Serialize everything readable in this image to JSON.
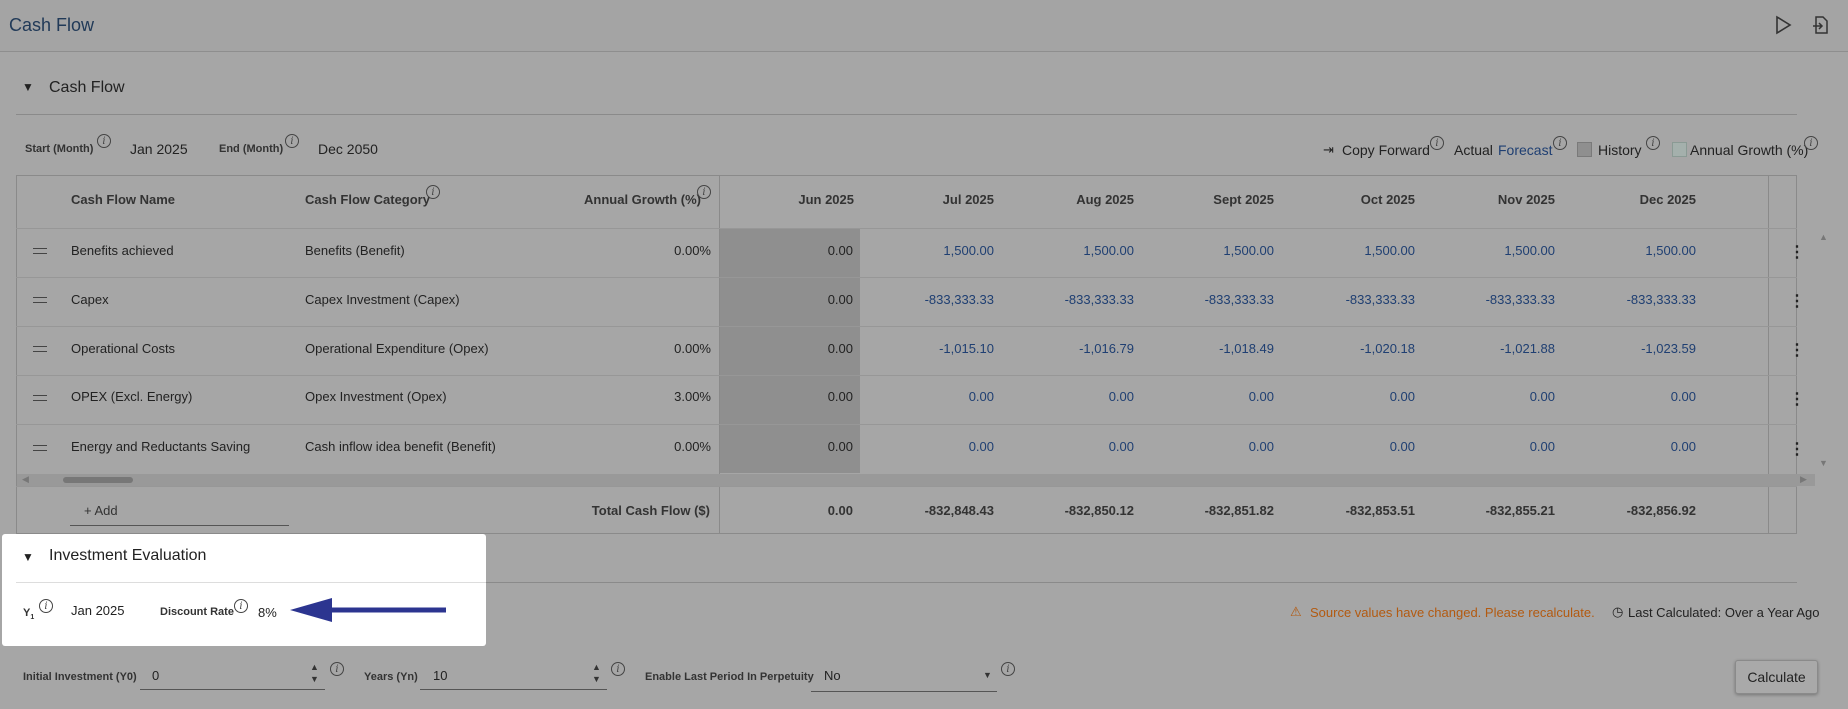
{
  "app": {
    "title": "Cash Flow"
  },
  "cashflow_section": {
    "title": "Cash Flow",
    "start_label": "Start (Month)",
    "start_value": "Jan 2025",
    "end_label": "End (Month)",
    "end_value": "Dec 2050",
    "legend": {
      "copy_forward": "Copy Forward",
      "actual": "Actual",
      "forecast": "Forecast",
      "history": "History",
      "annual_growth": "Annual Growth (%)"
    }
  },
  "grid": {
    "headers": {
      "name": "Cash Flow Name",
      "category": "Cash Flow Category",
      "growth": "Annual Growth (%)",
      "months": [
        "Jun 2025",
        "Jul 2025",
        "Aug 2025",
        "Sept 2025",
        "Oct 2025",
        "Nov 2025",
        "Dec 2025"
      ]
    },
    "rows": [
      {
        "name": "Benefits achieved",
        "category": "Benefits (Benefit)",
        "growth": "0.00%",
        "values": [
          "0.00",
          "1,500.00",
          "1,500.00",
          "1,500.00",
          "1,500.00",
          "1,500.00",
          "1,500.00"
        ]
      },
      {
        "name": "Capex",
        "category": "Capex Investment (Capex)",
        "growth": "",
        "values": [
          "0.00",
          "-833,333.33",
          "-833,333.33",
          "-833,333.33",
          "-833,333.33",
          "-833,333.33",
          "-833,333.33"
        ]
      },
      {
        "name": "Operational Costs",
        "category": "Operational Expenditure (Opex)",
        "growth": "0.00%",
        "values": [
          "0.00",
          "-1,015.10",
          "-1,016.79",
          "-1,018.49",
          "-1,020.18",
          "-1,021.88",
          "-1,023.59"
        ]
      },
      {
        "name": "OPEX (Excl. Energy)",
        "category": "Opex Investment (Opex)",
        "growth": "3.00%",
        "values": [
          "0.00",
          "0.00",
          "0.00",
          "0.00",
          "0.00",
          "0.00",
          "0.00"
        ]
      },
      {
        "name": "Energy and Reductants Saving",
        "category": "Cash inflow idea benefit (Benefit)",
        "growth": "0.00%",
        "values": [
          "0.00",
          "0.00",
          "0.00",
          "0.00",
          "0.00",
          "0.00",
          "0.00"
        ]
      }
    ],
    "add_label": "+ Add",
    "total_label": "Total Cash Flow ($)",
    "totals": [
      "0.00",
      "-832,848.43",
      "-832,850.12",
      "-832,851.82",
      "-832,853.51",
      "-832,855.21",
      "-832,856.92"
    ]
  },
  "investment": {
    "title": "Investment Evaluation",
    "y1_label": "Y",
    "y1_sub": "1",
    "y1_value": "Jan 2025",
    "discount_label": "Discount Rate",
    "discount_value": "8%",
    "warning": "Source values have changed. Please recalculate.",
    "last_calculated": "Last Calculated: Over a Year Ago",
    "initial_investment_label": "Initial Investment (Y0)",
    "initial_investment_value": "0",
    "years_label": "Years (Yn)",
    "years_value": "10",
    "perpetuity_label": "Enable Last Period In Perpetuity",
    "perpetuity_value": "No",
    "calculate_label": "Calculate"
  },
  "colors": {
    "overlay_bg": "#a6a6a6",
    "link_blue": "#1f3f72",
    "warning_orange": "#b35a10",
    "arrow_blue": "#2c3590"
  }
}
